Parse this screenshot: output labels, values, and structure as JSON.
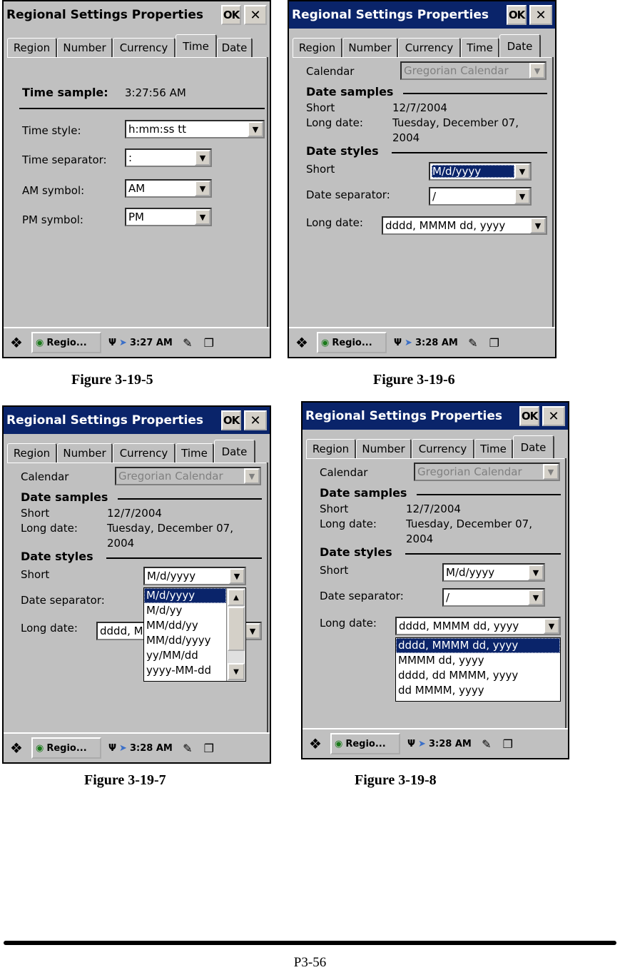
{
  "window_title": "Regional Settings Properties",
  "ok_label": "OK",
  "close_glyph": "✕",
  "tabs": [
    "Region",
    "Number",
    "Currency",
    "Time",
    "Date"
  ],
  "taskbar": {
    "start_icon": "windows-flag-icon",
    "task_label": "Regio...",
    "time_a": "3:27 AM",
    "time_b": "3:28 AM"
  },
  "time_panel": {
    "sample_label": "Time sample:",
    "sample_value": "3:27:56 AM",
    "style_label": "Time style:",
    "style_value": "h:mm:ss tt",
    "separator_label": "Time separator:",
    "separator_value": ":",
    "am_label": "AM symbol:",
    "am_value": "AM",
    "pm_label": "PM symbol:",
    "pm_value": "PM"
  },
  "date_panel": {
    "calendar_label": "Calendar",
    "calendar_value": "Gregorian Calendar",
    "samples_heading": "Date samples",
    "short_label": "Short",
    "short_sample": "12/7/2004",
    "long_label": "Long date:",
    "long_sample_l1": "Tuesday, December 07,",
    "long_sample_l2": "2004",
    "styles_heading": "Date styles",
    "short_style_label": "Short",
    "short_style_value": "M/d/yyyy",
    "separator_label": "Date separator:",
    "separator_value": "/",
    "long_style_label": "Long date:",
    "long_style_value": "dddd, MMMM dd, yyyy",
    "long_style_value_cut": "dddd, M"
  },
  "short_options": [
    "M/d/yyyy",
    "M/d/yy",
    "MM/dd/yy",
    "MM/dd/yyyy",
    "yy/MM/dd",
    "yyyy-MM-dd"
  ],
  "long_options": [
    "dddd, MMMM dd, yyyy",
    "MMMM dd, yyyy",
    "dddd, dd MMMM, yyyy",
    "dd MMMM, yyyy"
  ],
  "captions": [
    "Figure  3-19-5",
    "Figure 3-19-6",
    "Figure 3-19-7",
    "Figure 3-19-8"
  ],
  "page_number": "P3-56"
}
